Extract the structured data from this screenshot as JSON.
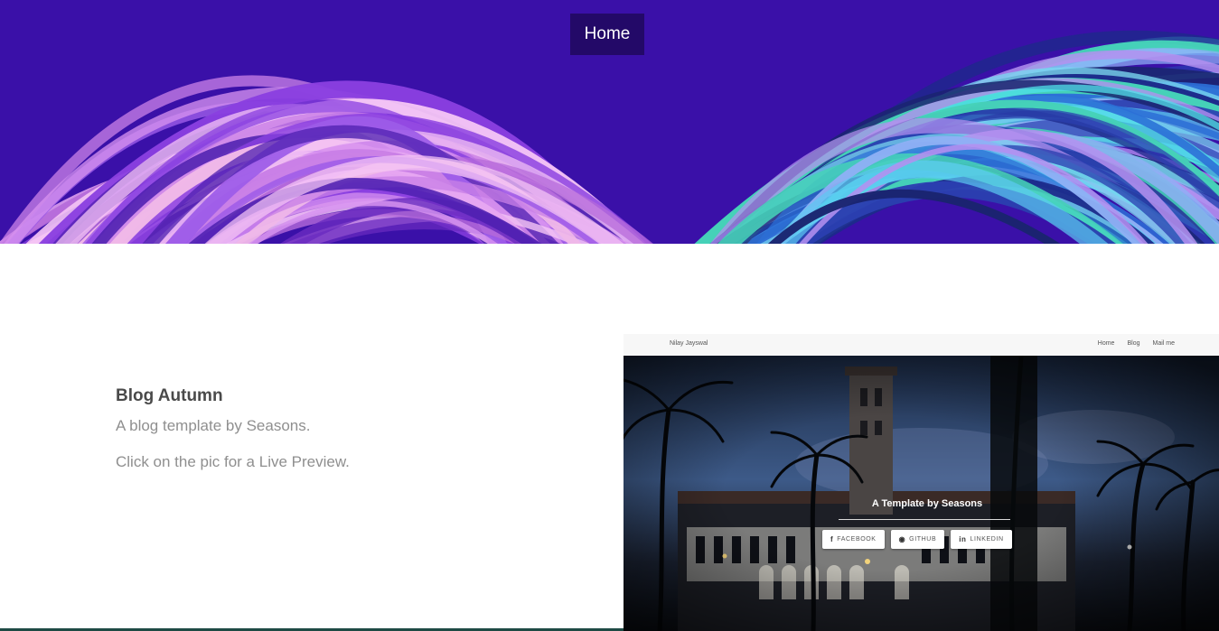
{
  "header": {
    "nav_home_label": "Home"
  },
  "project": {
    "title": "Blog Autumn",
    "description": "A blog template by Seasons.",
    "hint": "Click on the pic for a Live Preview."
  },
  "preview": {
    "brand": "Nilay Jayswal",
    "menu": [
      "Home",
      "Blog",
      "Mail me"
    ],
    "heading": "A Template by Seasons",
    "buttons": [
      {
        "icon": "facebook-icon",
        "glyph": "f",
        "label": "FACEBOOK"
      },
      {
        "icon": "github-icon",
        "glyph": "◉",
        "label": "GITHUB"
      },
      {
        "icon": "linkedin-icon",
        "glyph": "in",
        "label": "LINKEDIN"
      }
    ]
  },
  "colors": {
    "hero_base": "#3a10a8",
    "nav_highlight": "#1e085a",
    "title_text": "#4a4a4a",
    "body_text": "#8f8f8f",
    "footer_strip": "#1e4a44"
  }
}
